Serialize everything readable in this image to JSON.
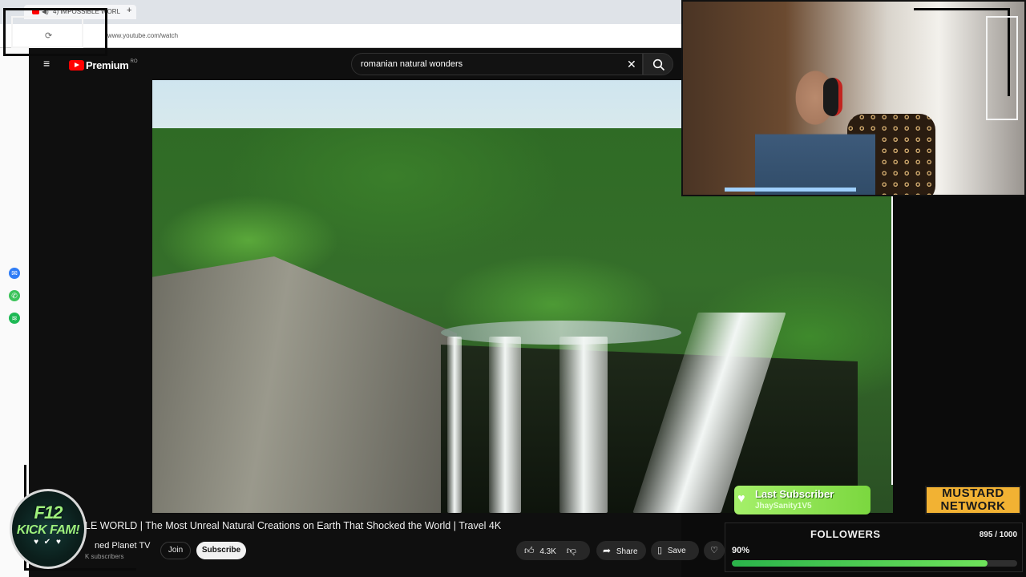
{
  "browser": {
    "tab_title": "4) IMPOSSIBLE WORL",
    "new_tab_label": "+",
    "url": "www.youtube.com/watch"
  },
  "youtube": {
    "logo_text": "Premium",
    "logo_region": "RO",
    "search_query": "romanian natural wonders",
    "clear_icon": "close-icon",
    "search_icon": "search-icon"
  },
  "video": {
    "title": "LE WORLD | The Most Unreal Natural Creations on Earth That Shocked the World | Travel 4K",
    "channel": "ned Planet TV",
    "subscribers": "K subscribers",
    "join_label": "Join",
    "subscribe_label": "Subscribe",
    "likes": "4.3K",
    "share_label": "Share",
    "save_label": "Save"
  },
  "overlay": {
    "badge_line1": "F12",
    "badge_line2": "KICK FAM!",
    "badge_line3": "♥ ✔ ♥",
    "last_subscriber_title": "Last Subscriber",
    "last_subscriber_name": "JhaySanity1V5",
    "brand_line1": "MUSTARD",
    "brand_line2": "NETWORK",
    "followers_title": "FOLLOWERS",
    "followers_count": "895 / 1000",
    "followers_percent_label": "90%",
    "followers_progress": 0.895
  },
  "colors": {
    "yt_red": "#ff0000",
    "accent_green": "#7bd73f",
    "mustard": "#f2b233"
  }
}
